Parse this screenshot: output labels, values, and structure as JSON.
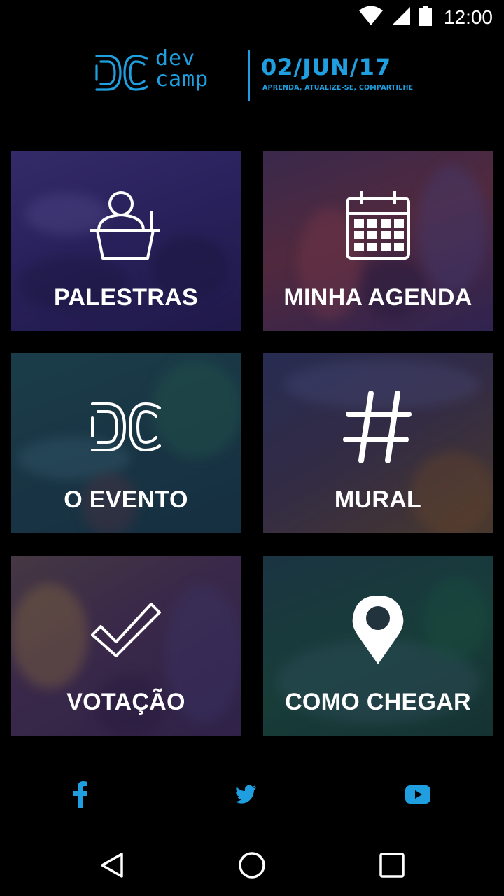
{
  "status_bar": {
    "time": "12:00",
    "icons": [
      "wifi-icon",
      "signal-icon",
      "battery-icon"
    ]
  },
  "header": {
    "logo_dev": "dev",
    "logo_camp": "camp",
    "date": "02/JUN/17",
    "tagline": "APRENDA, ATUALIZE-SE, COMPARTILHE"
  },
  "tiles": [
    {
      "label": "PALESTRAS",
      "icon": "speaker-podium-icon"
    },
    {
      "label": "MINHA AGENDA",
      "icon": "calendar-icon"
    },
    {
      "label": "O EVENTO",
      "icon": "devcamp-logo-icon"
    },
    {
      "label": "MURAL",
      "icon": "hashtag-icon"
    },
    {
      "label": "VOTAÇÃO",
      "icon": "checkmark-icon"
    },
    {
      "label": "COMO CHEGAR",
      "icon": "map-pin-icon"
    }
  ],
  "social": [
    "facebook-icon",
    "twitter-icon",
    "youtube-icon"
  ],
  "navigation": [
    "back-icon",
    "home-icon",
    "recents-icon"
  ],
  "colors": {
    "brand_blue": "#1f9fe0",
    "background": "#000000",
    "label": "#ffffff"
  }
}
